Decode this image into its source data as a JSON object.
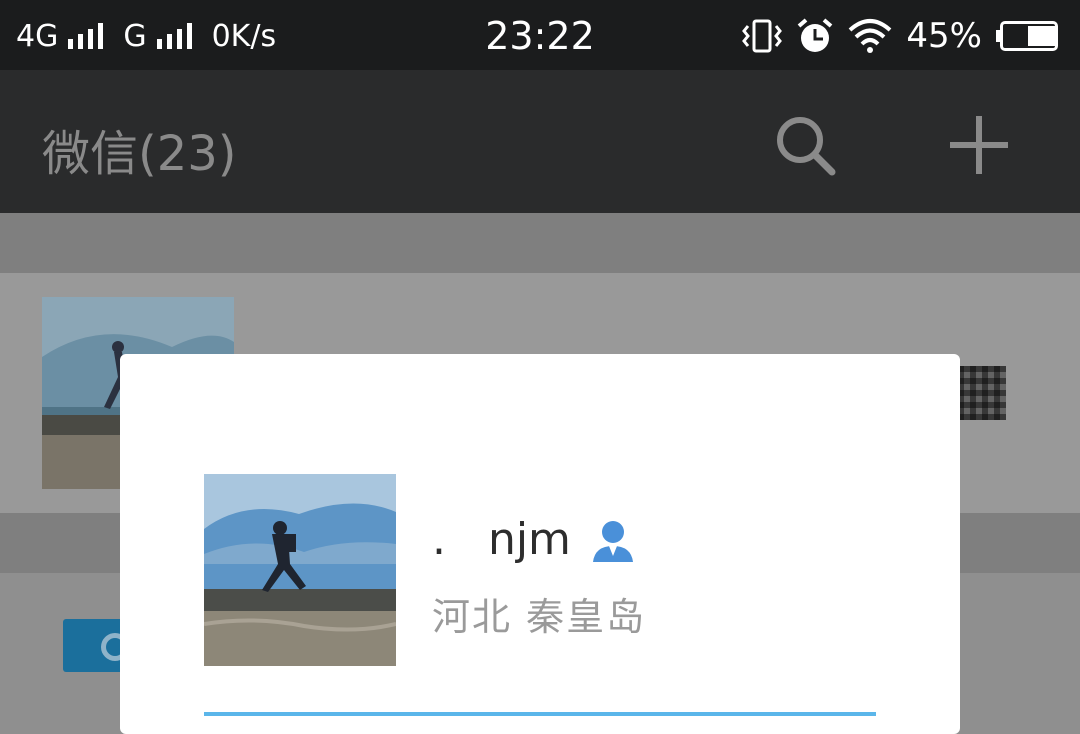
{
  "status_bar": {
    "network_1": "4G",
    "network_2": "G",
    "speed": "0K/s",
    "time": "23:22",
    "battery": "45%"
  },
  "header": {
    "title": "微信(23)",
    "icons": [
      "search-icon",
      "plus-icon"
    ]
  },
  "dialog": {
    "name": ".   njm",
    "region": "河北 秦皇岛"
  },
  "colors": {
    "status_bar_bg": "#1b1c1d",
    "header_bg": "#2a2b2c",
    "overlay_bg": "#8f8f8f",
    "dialog_bg": "#ffffff",
    "accent": "#5bb6ea",
    "contact_icon": "#4a90d9"
  }
}
